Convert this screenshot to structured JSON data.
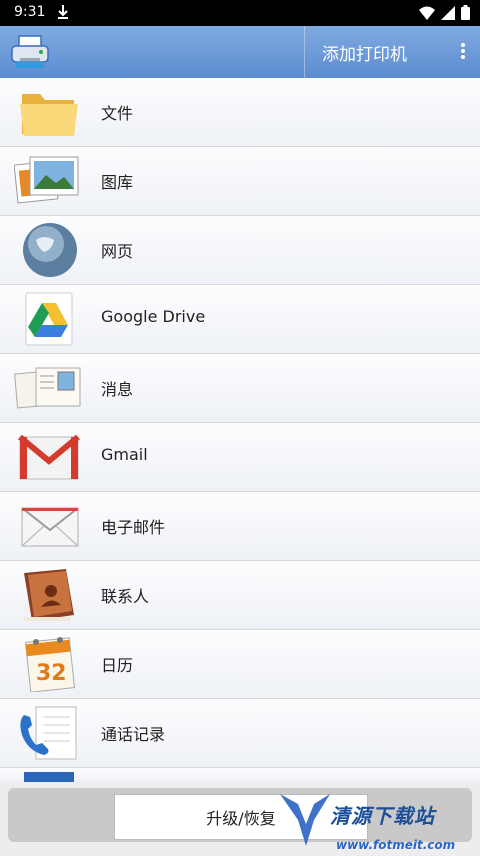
{
  "status_bar": {
    "time": "9:31"
  },
  "appbar": {
    "title": "添加打印机"
  },
  "items": [
    {
      "label": "文件",
      "icon": "folder-icon"
    },
    {
      "label": "图库",
      "icon": "gallery-icon"
    },
    {
      "label": "网页",
      "icon": "globe-icon"
    },
    {
      "label": "Google Drive",
      "icon": "google-drive-icon"
    },
    {
      "label": "消息",
      "icon": "message-icon"
    },
    {
      "label": "Gmail",
      "icon": "gmail-icon"
    },
    {
      "label": "电子邮件",
      "icon": "envelope-icon"
    },
    {
      "label": "联系人",
      "icon": "contacts-book-icon"
    },
    {
      "label": "日历",
      "icon": "calendar-icon",
      "calendar_number": "32"
    },
    {
      "label": "通话记录",
      "icon": "phone-log-icon"
    }
  ],
  "bottom": {
    "upgrade_label": "升级/恢复"
  },
  "watermark": {
    "text": "清源下载站",
    "url": "www.fotmeit.com"
  }
}
